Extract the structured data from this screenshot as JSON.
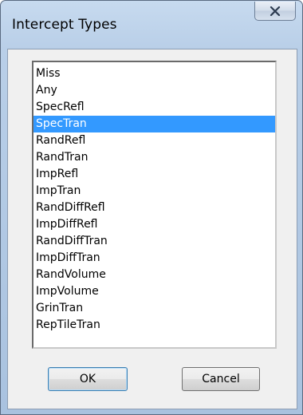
{
  "window": {
    "title": "Intercept Types",
    "close_glyph": "✕",
    "close_icon": "close-icon"
  },
  "list": {
    "selected_index": 3,
    "items": [
      "Miss",
      "Any",
      "SpecRefl",
      "SpecTran",
      "RandRefl",
      "RandTran",
      "ImpRefl",
      "ImpTran",
      "RandDiffRefl",
      "ImpDiffRefl",
      "RandDiffTran",
      "ImpDiffTran",
      "RandVolume",
      "ImpVolume",
      "GrinTran",
      "RepTileTran"
    ]
  },
  "buttons": {
    "ok_label": "OK",
    "cancel_label": "Cancel"
  },
  "colors": {
    "selection": "#3399ff",
    "selection_text": "#ffffff"
  }
}
